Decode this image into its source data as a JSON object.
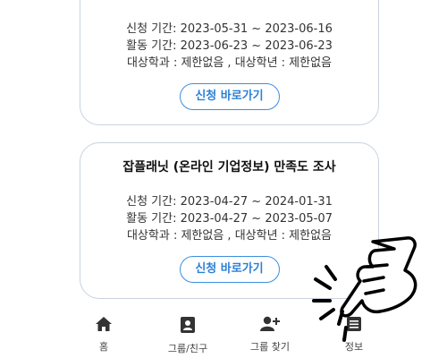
{
  "cards": [
    {
      "title": "",
      "apply_period": "신청 기간: 2023-05-31 ~ 2023-06-16",
      "activity_period": "활동 기간: 2023-06-23 ~ 2023-06-23",
      "target": "대상학과 : 제한없음 , 대상학년 : 제한없음",
      "button_label": "신청 바로가기"
    },
    {
      "title": "잡플래닛 (온라인 기업정보) 만족도 조사",
      "apply_period": "신청 기간: 2023-04-27 ~ 2024-01-31",
      "activity_period": "활동 기간: 2023-04-27 ~ 2023-05-07",
      "target": "대상학과 : 제한없음 , 대상학년 : 제한없음",
      "button_label": "신청 바로가기"
    }
  ],
  "nav": {
    "items": [
      {
        "label": "홈",
        "icon": "home-icon"
      },
      {
        "label": "그룹/친구",
        "icon": "id-card-icon"
      },
      {
        "label": "그룹 찾기",
        "icon": "add-user-icon"
      },
      {
        "label": "정보",
        "icon": "info-list-icon"
      }
    ]
  },
  "overlay": {
    "icon": "tap-hand-icon"
  }
}
